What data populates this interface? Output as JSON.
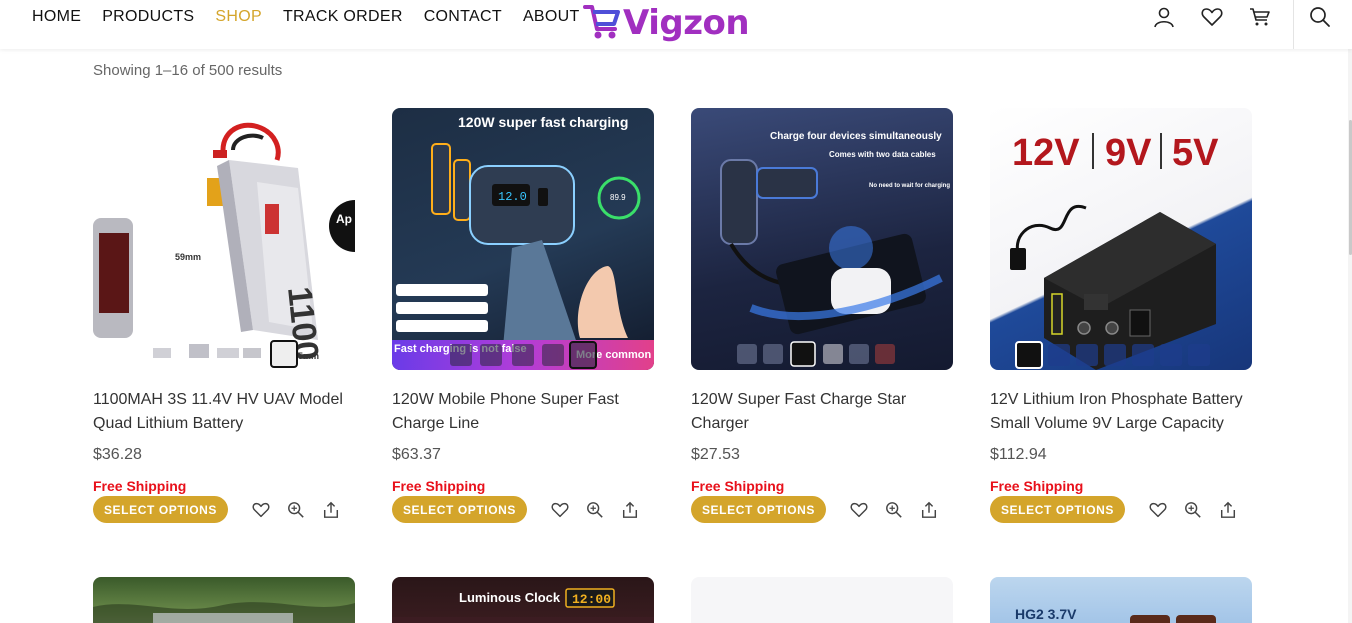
{
  "nav": {
    "items": [
      {
        "label": "HOME"
      },
      {
        "label": "PRODUCTS"
      },
      {
        "label": "SHOP"
      },
      {
        "label": "TRACK ORDER"
      },
      {
        "label": "CONTACT"
      },
      {
        "label": "ABOUT"
      }
    ],
    "active": "SHOP"
  },
  "logo": {
    "text": "Vigzon"
  },
  "header_icons": [
    "user-icon",
    "heart-icon",
    "cart-icon",
    "search-icon"
  ],
  "results": {
    "text": "Showing 1–16 of 500 results"
  },
  "colors": {
    "accent": "#d4a52b",
    "free_shipping": "#e8101a",
    "logo_purple": "#a12fc0"
  },
  "products": [
    {
      "title": "1100MAH 3S 11.4V HV UAV Model Quad Lithium Battery",
      "price": "$36.28",
      "free_shipping": "Free Shipping",
      "button": "SELECT OPTIONS",
      "image_text": {
        "dim_a": "59mm",
        "dim_b": "5mm",
        "label": "1100",
        "badge": "Ap"
      }
    },
    {
      "title": "120W Mobile Phone Super Fast Charge Line",
      "price": "$63.37",
      "free_shipping": "Free Shipping",
      "button": "SELECT OPTIONS",
      "image_text": {
        "headline": "120W super fast charging",
        "readout": "89.9",
        "banner": "Fast charging is not false",
        "banner_tail": "More common"
      }
    },
    {
      "title": "120W Super Fast Charge Star Charger",
      "price": "$27.53",
      "free_shipping": "Free Shipping",
      "button": "SELECT OPTIONS",
      "image_text": {
        "line1": "Charge four devices simultaneously",
        "line2": "Comes with two data cables",
        "line3": "No need to wait for charging"
      }
    },
    {
      "title": "12V Lithium Iron Phosphate Battery Small Volume 9V Large Capacity",
      "price": "$112.94",
      "free_shipping": "Free Shipping",
      "button": "SELECT OPTIONS",
      "image_text": {
        "v1": "12V",
        "v2": "9V",
        "v3": "5V"
      }
    }
  ],
  "row2_image_text": {
    "clock_title": "Luminous Clock",
    "clock_time": "12:00",
    "battery_label": "HG2 3.7V"
  }
}
